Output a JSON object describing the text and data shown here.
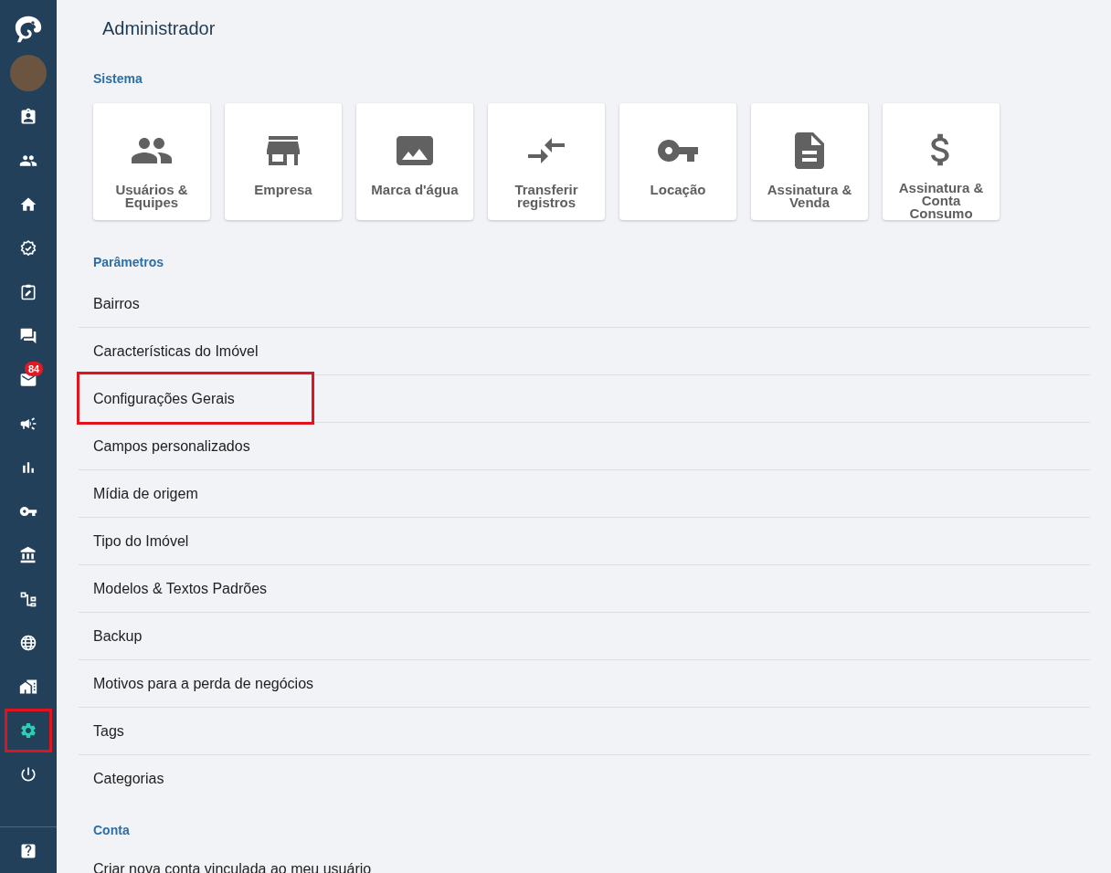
{
  "sidebar": {
    "items": [
      {
        "kind": "logo",
        "selected": false,
        "highlighted": false
      },
      {
        "kind": "avatar",
        "selected": false,
        "highlighted": false
      },
      {
        "kind": "contact",
        "selected": false,
        "highlighted": false
      },
      {
        "kind": "people",
        "selected": false,
        "highlighted": false
      },
      {
        "kind": "home",
        "selected": false,
        "highlighted": false
      },
      {
        "kind": "verified",
        "selected": false,
        "highlighted": false
      },
      {
        "kind": "task",
        "selected": false,
        "highlighted": false
      },
      {
        "kind": "chat",
        "selected": false,
        "highlighted": false
      },
      {
        "kind": "mail",
        "selected": false,
        "highlighted": false,
        "badge": "84"
      },
      {
        "kind": "megaphone",
        "selected": false,
        "highlighted": false
      },
      {
        "kind": "chart",
        "selected": false,
        "highlighted": false
      },
      {
        "kind": "key",
        "selected": false,
        "highlighted": false
      },
      {
        "kind": "bank",
        "selected": false,
        "highlighted": false
      },
      {
        "kind": "tree",
        "selected": false,
        "highlighted": false
      },
      {
        "kind": "globe",
        "selected": false,
        "highlighted": false
      },
      {
        "kind": "buildings",
        "selected": false,
        "highlighted": false
      },
      {
        "kind": "settings",
        "selected": true,
        "highlighted": true
      },
      {
        "kind": "power",
        "selected": false,
        "highlighted": false
      }
    ],
    "footer": [
      {
        "kind": "help",
        "selected": false,
        "highlighted": false
      }
    ]
  },
  "header": {
    "title": "Administrador"
  },
  "sections": [
    {
      "title": "Sistema",
      "cards": [
        {
          "kind": "people",
          "label": "Usuários & Equipes"
        },
        {
          "kind": "store",
          "label": "Empresa"
        },
        {
          "kind": "image",
          "label": "Marca d'água"
        },
        {
          "kind": "transfer",
          "label": "Transferir registros"
        },
        {
          "kind": "key",
          "label": "Locação"
        },
        {
          "kind": "document",
          "label": "Assinatura & Venda"
        },
        {
          "kind": "dollar",
          "label": "Assinatura & Conta Consumo"
        }
      ]
    },
    {
      "title": "Parâmetros",
      "rows": [
        {
          "label": "Bairros",
          "highlighted": false
        },
        {
          "label": "Características do Imóvel",
          "highlighted": false
        },
        {
          "label": "Configurações Gerais",
          "highlighted": true
        },
        {
          "label": "Campos personalizados",
          "highlighted": false
        },
        {
          "label": "Mídia de origem",
          "highlighted": false
        },
        {
          "label": "Tipo do Imóvel",
          "highlighted": false
        },
        {
          "label": "Modelos & Textos Padrões",
          "highlighted": false
        },
        {
          "label": "Backup",
          "highlighted": false
        },
        {
          "label": "Motivos para a perda de negócios",
          "highlighted": false
        },
        {
          "label": "Tags",
          "highlighted": false
        },
        {
          "label": "Categorias",
          "highlighted": false
        }
      ]
    },
    {
      "title": "Conta",
      "rows": [
        {
          "label": "Criar nova conta vinculada ao meu usuário",
          "highlighted": false
        }
      ]
    }
  ]
}
